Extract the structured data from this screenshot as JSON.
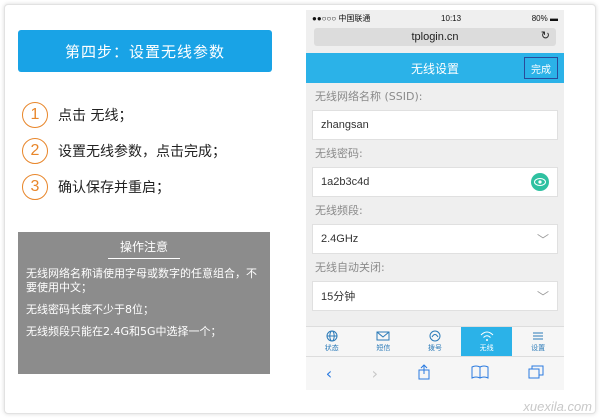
{
  "left": {
    "banner": "第四步：设置无线参数",
    "steps": [
      {
        "num": "1",
        "text": "点击 无线；"
      },
      {
        "num": "2",
        "text": "设置无线参数，点击完成；"
      },
      {
        "num": "3",
        "text": "确认保存并重启；"
      }
    ],
    "note": {
      "title": "操作注意",
      "lines": [
        "无线网络名称请使用字母或数字的任意组合，不要使用中文；",
        "无线密码长度不少于8位；",
        "无线频段只能在2.4G和5G中选择一个；"
      ]
    }
  },
  "phone": {
    "status": {
      "carrier": "●●○○○ 中国联通",
      "time": "10:13",
      "battery": "80%"
    },
    "url": "tplogin.cn",
    "header": {
      "title": "无线设置",
      "done": "完成"
    },
    "fields": {
      "ssid": {
        "label": "无线网络名称 (SSID):",
        "value": "zhangsan"
      },
      "password": {
        "label": "无线密码:",
        "value": "1a2b3c4d"
      },
      "band": {
        "label": "无线频段:",
        "value": "2.4GHz"
      },
      "auto_off": {
        "label": "无线自动关闭:",
        "value": "15分钟"
      }
    },
    "tabs": [
      {
        "label": "状态",
        "icon": "globe-icon"
      },
      {
        "label": "短信",
        "icon": "mail-icon"
      },
      {
        "label": "拨号",
        "icon": "dialup-icon"
      },
      {
        "label": "无线",
        "icon": "wifi-icon"
      },
      {
        "label": "设置",
        "icon": "menu-icon"
      }
    ]
  },
  "watermark": "xuexila.com",
  "colors": {
    "accent": "#2bb2e8",
    "step_orange": "#e8862a",
    "note_gray": "#8c8c8c"
  }
}
